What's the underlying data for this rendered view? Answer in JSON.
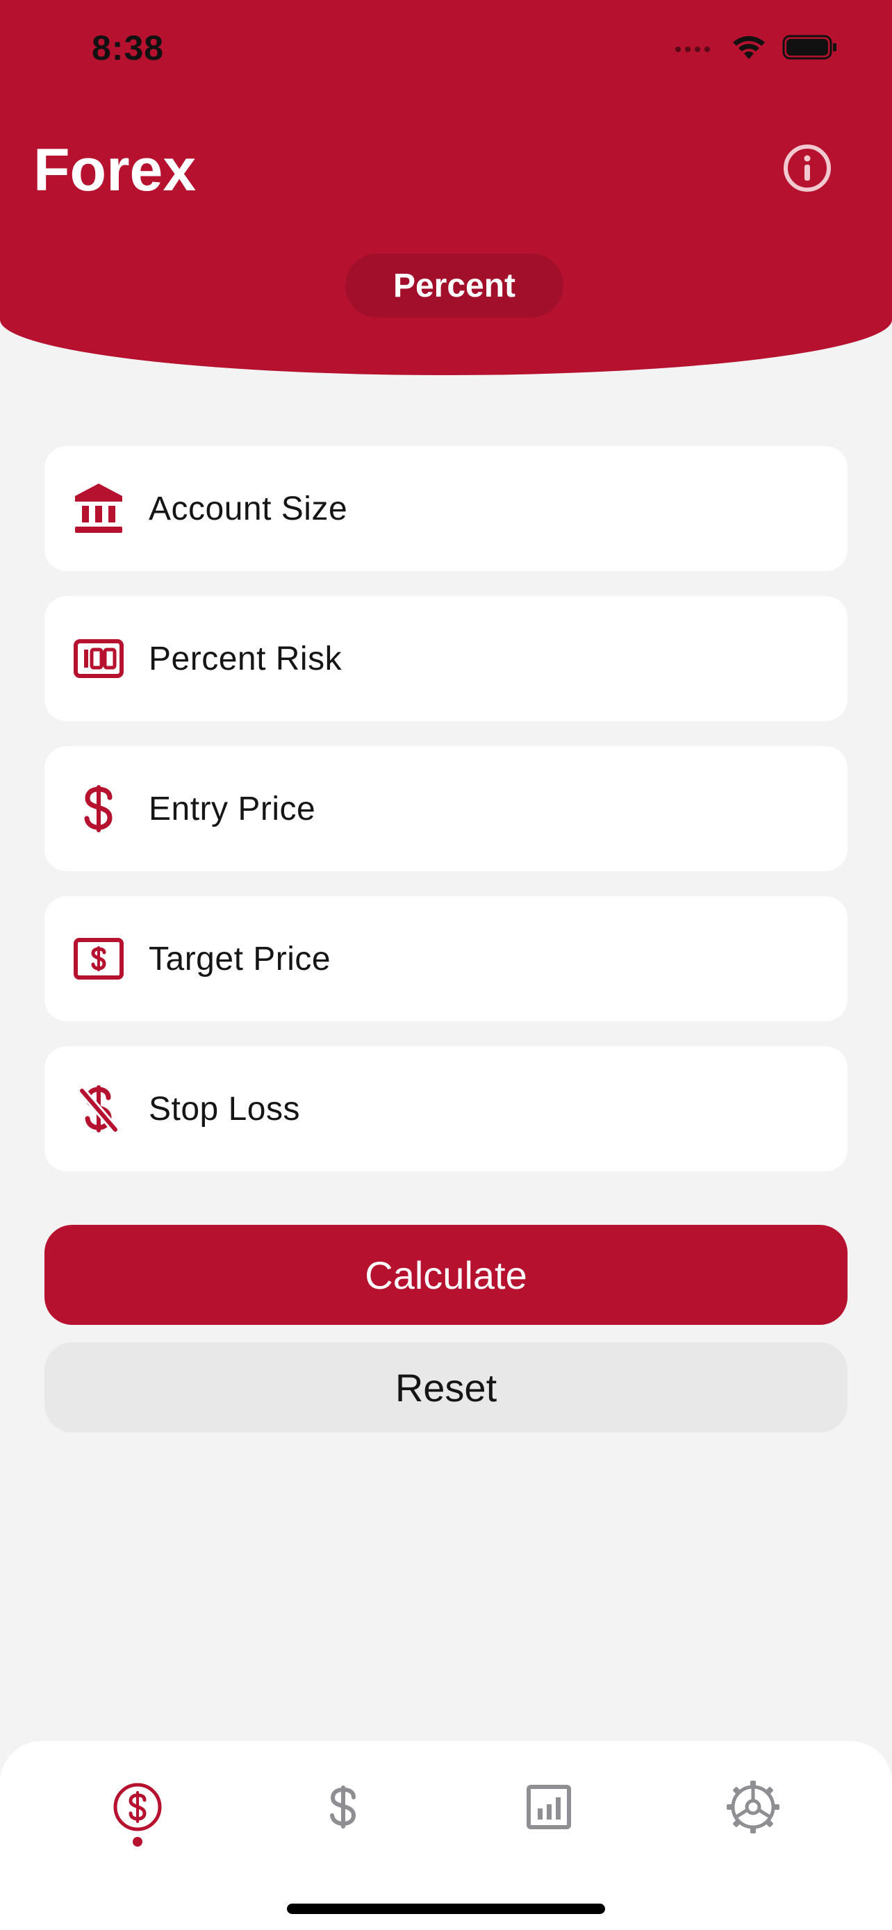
{
  "status_bar": {
    "time": "8:38"
  },
  "header": {
    "title": "Forex",
    "mode": "Percent"
  },
  "fields": [
    {
      "icon": "bank-icon",
      "label": "Account Size"
    },
    {
      "icon": "percent-badge-icon",
      "label": "Percent Risk"
    },
    {
      "icon": "dollar-icon",
      "label": "Entry Price"
    },
    {
      "icon": "dollar-bill-icon",
      "label": "Target Price"
    },
    {
      "icon": "dollar-slash-icon",
      "label": "Stop Loss"
    }
  ],
  "buttons": {
    "calculate": "Calculate",
    "reset": "Reset"
  },
  "tabs": [
    {
      "icon": "dollar-circle-icon",
      "active": true
    },
    {
      "icon": "dollar-icon",
      "active": false
    },
    {
      "icon": "chart-icon",
      "active": false
    },
    {
      "icon": "settings-gear-icon",
      "active": false
    }
  ],
  "colors": {
    "accent": "#b61230",
    "background": "#f3f3f3",
    "inactive": "#8e8e93"
  }
}
